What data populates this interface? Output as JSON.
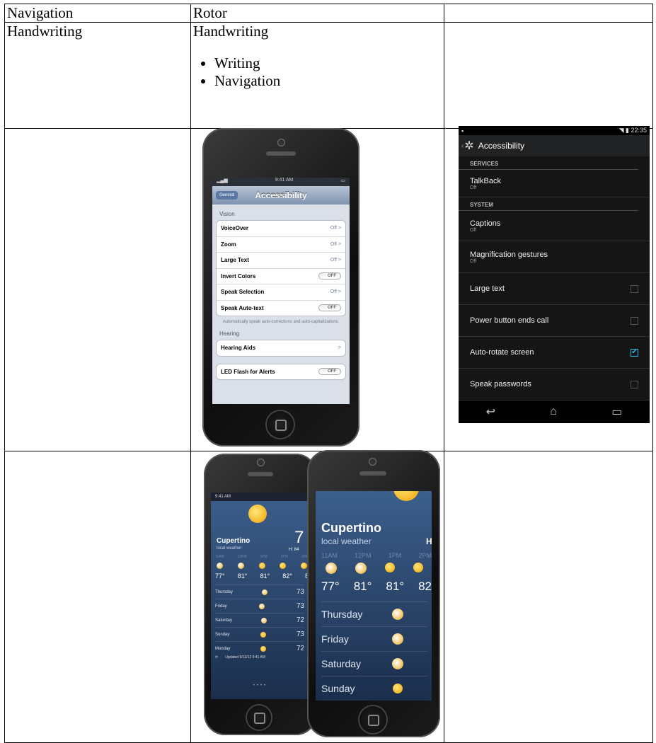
{
  "table": {
    "rows": [
      {
        "col1": "Navigation",
        "col2": "Rotor",
        "col3": ""
      },
      {
        "col1": "Handwriting",
        "col2": "Handwriting",
        "col2_bullets": [
          "Writing",
          "Navigation"
        ],
        "col3": ""
      }
    ]
  },
  "ios_settings": {
    "status_time": "9:41 AM",
    "back_button": "General",
    "title": "Accessibility",
    "vision_header": "Vision",
    "vision_rows": [
      {
        "label": "VoiceOver",
        "value": "Off >"
      },
      {
        "label": "Zoom",
        "value": "Off >"
      },
      {
        "label": "Large Text",
        "value": "Off >"
      },
      {
        "label": "Invert Colors",
        "value": "OFF"
      },
      {
        "label": "Speak Selection",
        "value": "Off >"
      },
      {
        "label": "Speak Auto-text",
        "value": "OFF"
      }
    ],
    "auto_text_note": "Automatically speak auto-corrections and auto-capitalizations.",
    "hearing_header": "Hearing",
    "hearing_rows": [
      {
        "label": "Hearing Aids",
        "value": ">"
      }
    ],
    "led_row": {
      "label": "LED Flash for Alerts",
      "value": "OFF"
    }
  },
  "android_settings": {
    "time": "22:35",
    "title": "Accessibility",
    "services_header": "SERVICES",
    "services": [
      {
        "title": "TalkBack",
        "sub": "Off"
      }
    ],
    "system_header": "SYSTEM",
    "system": [
      {
        "title": "Captions",
        "sub": "Off"
      },
      {
        "title": "Magnification gestures",
        "sub": "Off"
      }
    ],
    "checkbox_items": [
      {
        "title": "Large text",
        "checked": false
      },
      {
        "title": "Power button ends call",
        "checked": false
      },
      {
        "title": "Auto-rotate screen",
        "checked": true
      },
      {
        "title": "Speak passwords",
        "checked": false
      }
    ]
  },
  "weather_small": {
    "status_time": "9:41 AM",
    "city": "Cupertino",
    "sub": "local weather",
    "temp_now": "7",
    "hi": "H: 84",
    "hours": [
      "11AM",
      "12PM",
      "1PM",
      "2PM",
      "3PM"
    ],
    "hour_temps": [
      "77°",
      "81°",
      "81°",
      "82°",
      "8"
    ],
    "days": [
      {
        "name": "Thursday",
        "temp": "73"
      },
      {
        "name": "Friday",
        "temp": "73"
      },
      {
        "name": "Saturday",
        "temp": "72"
      },
      {
        "name": "Sunday",
        "temp": "73"
      },
      {
        "name": "Monday",
        "temp": "72"
      }
    ],
    "updated": "Updated 9/12/12 9:41 AM"
  },
  "weather_large": {
    "city": "Cupertino",
    "sub": "local weather",
    "hi": "H",
    "hours": [
      "11AM",
      "12PM",
      "1PM",
      "2PM"
    ],
    "hour_temps": [
      "77°",
      "81°",
      "81°",
      "82"
    ],
    "days": [
      "Thursday",
      "Friday",
      "Saturday",
      "Sunday"
    ]
  }
}
